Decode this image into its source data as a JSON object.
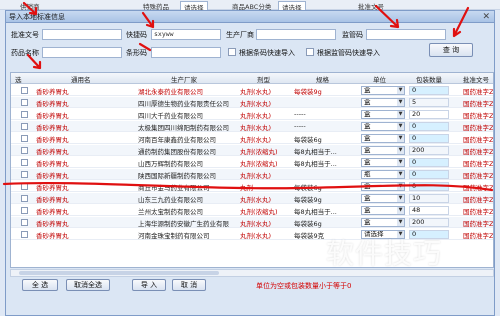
{
  "app_strip": {
    "label1": "供销商",
    "label2": "特殊药品",
    "select1": "请选择",
    "label3": "商品ABC分类",
    "select2": "请选择",
    "label4": "批准文号"
  },
  "dialog": {
    "title": "导入本地标准信息",
    "close_glyph": "✕"
  },
  "filters": {
    "approval_no_label": "批准文号",
    "approval_no_value": "",
    "quick_code_label": "快捷码",
    "quick_code_value": "sxyww",
    "manufacturer_label": "生产厂商",
    "manufacturer_value": "",
    "regulatory_code_label": "监管码",
    "regulatory_code_value": "",
    "drug_name_label": "药品名称",
    "drug_name_value": "",
    "bar_code_label": "条形码",
    "bar_code_value": "",
    "cb_approval_import": "根据条码快速导入",
    "cb_regulatory_import": "根据监管码快速导入",
    "query_button": "查 询"
  },
  "grid": {
    "headers": [
      "选",
      "通用名",
      "生产厂家",
      "剂型",
      "规格",
      "单位",
      "包装数量",
      "批准文号"
    ],
    "rows": [
      {
        "name": "香砂养胃丸",
        "maker": "湖北永泰药业有限公司",
        "maker_red": true,
        "form": "丸剂(水丸)",
        "spec": "每袋装9g",
        "spec_red": true,
        "unit": "盒",
        "qty": "0",
        "approval": "国药准字Z4"
      },
      {
        "name": "香砂养胃丸",
        "maker": "四川厚德生物药业有限责任公司",
        "maker_red": false,
        "form": "丸剂(水丸)",
        "spec": "",
        "spec_red": false,
        "unit": "盒",
        "qty": "5",
        "approval": "国药准字Z5"
      },
      {
        "name": "香砂养胃丸",
        "maker": "四川大千药业有限公司",
        "maker_red": false,
        "form": "丸剂(水丸)",
        "spec": "-----",
        "spec_red": false,
        "unit": "盒",
        "qty": "20",
        "approval": "国药准字Z5"
      },
      {
        "name": "香砂养胃丸",
        "maker": "太极集团四川绵阳制药有限公司",
        "maker_red": false,
        "form": "丸剂(水丸)",
        "spec": "-----",
        "spec_red": false,
        "unit": "盒",
        "qty": "0",
        "approval": "国药准字Z5"
      },
      {
        "name": "香砂养胃丸",
        "maker": "河南百年康鑫药业有限公司",
        "maker_red": false,
        "form": "丸剂(水丸)",
        "spec": "每袋装6g",
        "spec_red": false,
        "unit": "盒",
        "qty": "0",
        "approval": "国药准字Z4"
      },
      {
        "name": "香砂养胃丸",
        "maker": "通药制药集团股份有限公司",
        "maker_red": false,
        "form": "丸剂(浓缩丸)",
        "spec": "每8丸相当于...",
        "spec_red": false,
        "unit": "盒",
        "qty": "200",
        "approval": "国药准字Z2"
      },
      {
        "name": "香砂养胃丸",
        "maker": "山西万辉制药有限公司",
        "maker_red": false,
        "form": "丸剂(浓缩丸)",
        "spec": "每8丸相当于...",
        "spec_red": false,
        "unit": "盒",
        "qty": "0",
        "approval": "国药准字Z1"
      },
      {
        "name": "香砂养胃丸",
        "maker": "陕西国际新疆制药有限公司",
        "maker_red": false,
        "form": "丸剂(水丸)",
        "spec": "",
        "spec_red": false,
        "unit": "瓶",
        "qty": "0",
        "approval": "国药准字Z6"
      },
      {
        "name": "香砂养胃丸",
        "maker": "商丘市金马药业有限公司",
        "maker_red": false,
        "form": "丸剂",
        "spec": "每袋装6g",
        "spec_red": false,
        "unit": "盒",
        "qty": "0",
        "approval": "国药准字Z4"
      },
      {
        "name": "香砂养胃丸",
        "maker": "山东三九药业有限公司",
        "maker_red": false,
        "form": "丸剂(水丸)",
        "spec": "每袋装9g",
        "spec_red": false,
        "unit": "盒",
        "qty": "10",
        "approval": "国药准字Z3"
      },
      {
        "name": "香砂养胃丸",
        "maker": "兰州太宝制药有限公司",
        "maker_red": false,
        "form": "丸剂(浓缩丸)",
        "spec": "每8丸相当于...",
        "spec_red": false,
        "unit": "盒",
        "qty": "48",
        "approval": "国药准字Z6"
      },
      {
        "name": "香砂养胃丸",
        "maker": "上海华源制药安徽广生药业有限",
        "maker_red": false,
        "form": "丸剂(水丸)",
        "spec": "每袋装6g",
        "spec_red": false,
        "unit": "盒",
        "qty": "200",
        "approval": "国药准字Z3"
      },
      {
        "name": "香砂养胃丸",
        "maker": "河南金珠宝制药有限公司",
        "maker_red": false,
        "form": "丸剂(水丸)",
        "spec": "每袋装9克",
        "spec_red": false,
        "unit": "请选择",
        "qty": "0",
        "approval": "国药准字Z4"
      }
    ]
  },
  "footer": {
    "select_all": "全 选",
    "deselect_all": "取消全选",
    "import": "导 入",
    "cancel": "取 消",
    "note": "单位为空或包装数量小于等于0"
  },
  "watermark": "软件技巧",
  "colors": {
    "annotation": "#e01010",
    "alert_text": "#d40000"
  }
}
